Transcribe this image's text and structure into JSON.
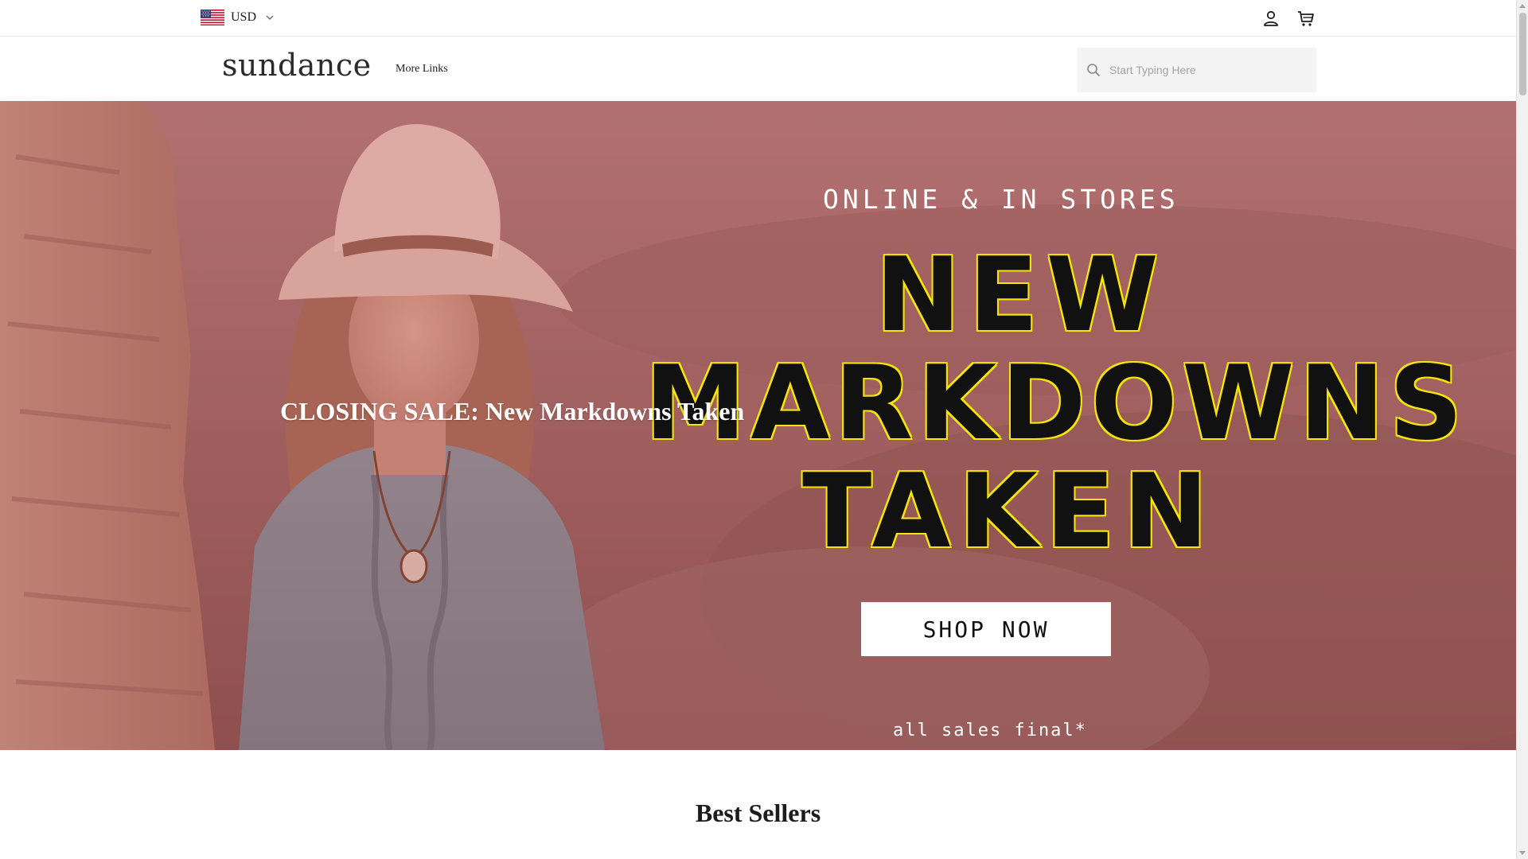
{
  "utility_bar": {
    "currency": "USD",
    "icons": [
      "us-flag-icon",
      "chevron-down-icon",
      "account-icon",
      "cart-icon"
    ]
  },
  "header": {
    "logo": "sundance",
    "nav": {
      "more_links": "More Links"
    },
    "search": {
      "placeholder": "Start Typing Here"
    }
  },
  "hero": {
    "kicker": "ONLINE & IN STORES",
    "headline": [
      "NEW",
      "MARKDOWNS",
      "TAKEN"
    ],
    "caption": "CLOSING SALE: New Markdowns Taken",
    "cta": "SHOP NOW",
    "fine_print": "all sales final*"
  },
  "best_sellers": {
    "title": "Best Sellers"
  },
  "colors": {
    "headline_fill": "#111111",
    "headline_outline": "#f5e50a",
    "hero_tint": "#a96f6d"
  }
}
